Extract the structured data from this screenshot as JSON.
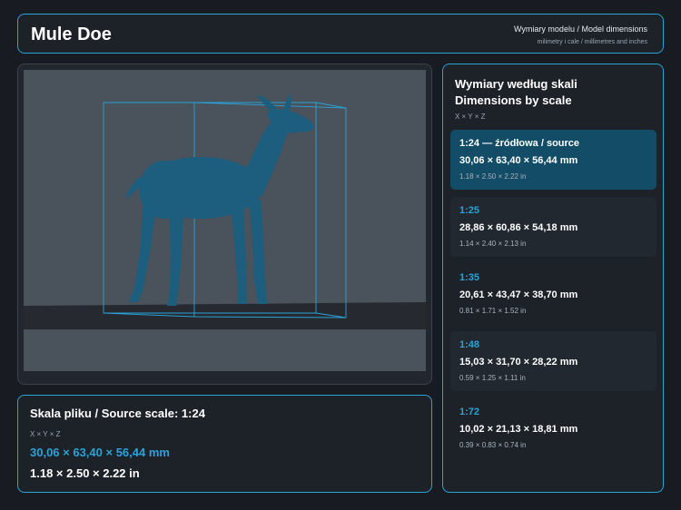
{
  "header": {
    "title": "Mule Doe",
    "subtitle": "Wymiary modelu / Model dimensions",
    "subtitle2": "milimetry i cale / millimetres and inches"
  },
  "viewer": {
    "model_icon": "deer-model-icon",
    "colors": {
      "background": "#4a525c",
      "floor": "#262a30",
      "model": "#1d5e7e",
      "bbox": "#2aa3d6"
    }
  },
  "source": {
    "heading": "Skala pliku / Source scale: 1:24",
    "axes": "X × Y × Z",
    "mm": "30,06 × 63,40 × 56,44 mm",
    "inches": "1.18 × 2.50 × 2.22 in"
  },
  "scales": {
    "title_line1": "Wymiary według skali",
    "title_line2": "Dimensions by scale",
    "axes": "X × Y × Z",
    "items": [
      {
        "label": "1:24  —  źródłowa / source",
        "mm": "30,06 × 63,40 × 56,44 mm",
        "inches": "1.18 × 2.50 × 2.22 in"
      },
      {
        "label": "1:25",
        "mm": "28,86 × 60,86 × 54,18 mm",
        "inches": "1.14 × 2.40 × 2.13 in"
      },
      {
        "label": "1:35",
        "mm": "20,61 × 43,47 × 38,70 mm",
        "inches": "0.81 × 1.71 × 1.52 in"
      },
      {
        "label": "1:48",
        "mm": "15,03 × 31,70 × 28,22 mm",
        "inches": "0.59 × 1.25 × 1.11 in"
      },
      {
        "label": "1:72",
        "mm": "10,02 × 21,13 × 18,81 mm",
        "inches": "0.39 × 0.83 × 0.74 in"
      }
    ]
  },
  "colors": {
    "accent": "#2aa3d6",
    "active_bg": "#134c66",
    "panel_bg": "#1d2229"
  }
}
